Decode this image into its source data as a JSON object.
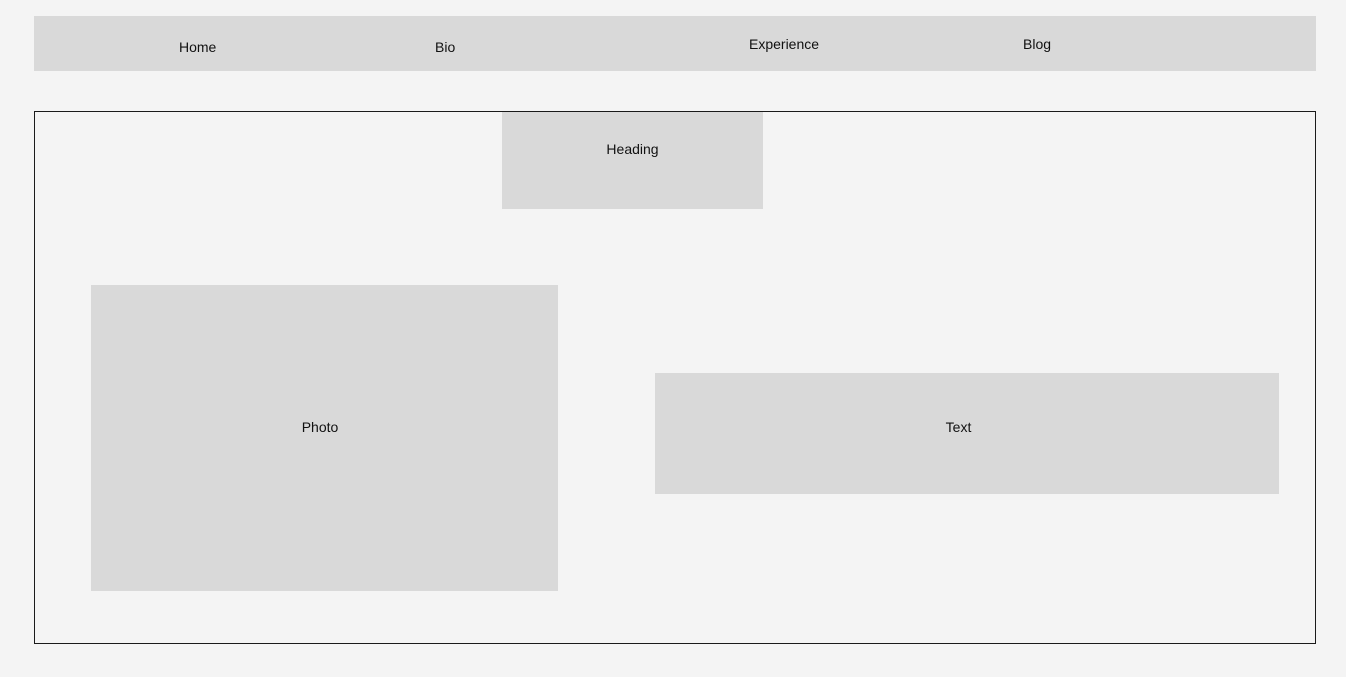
{
  "nav": {
    "items": [
      {
        "label": "Home"
      },
      {
        "label": "Bio"
      },
      {
        "label": "Experience"
      },
      {
        "label": "Blog"
      }
    ]
  },
  "main": {
    "heading": "Heading",
    "photo": "Photo",
    "text": "Text"
  },
  "colors": {
    "page_background": "#f4f4f4",
    "placeholder_fill": "#d9d9d9",
    "frame_border": "#1a1a1a",
    "text": "#111111"
  }
}
